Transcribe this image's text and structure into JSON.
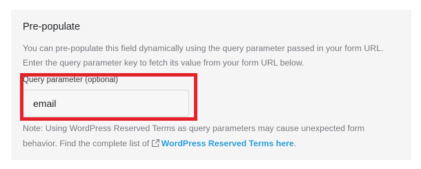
{
  "section": {
    "title": "Pre-populate",
    "description": "You can pre-populate this field dynamically using the query parameter passed in your form URL. Enter the query parameter key to fetch its value from your form URL below."
  },
  "query_field": {
    "label": "Query parameter (optional)",
    "value": "email"
  },
  "note": {
    "text": "Note: Using WordPress Reserved Terms as query parameters may cause unexpected form behavior. Find the complete list of",
    "link_text": "WordPress Reserved Terms here",
    "suffix": "."
  },
  "colors": {
    "highlight": "#e4222a",
    "link": "#2b9ed8"
  },
  "icons": {
    "link_icon": "external-link-icon"
  }
}
